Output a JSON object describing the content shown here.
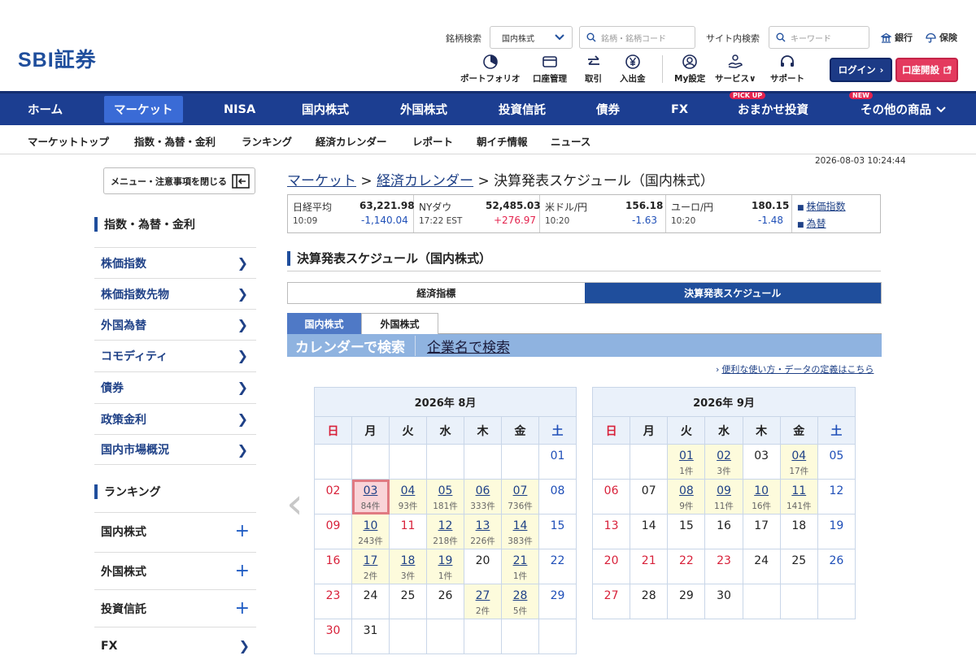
{
  "header": {
    "logo": "SBI証券",
    "stock_search_label": "銘柄検索",
    "stock_search_select": "国内株式",
    "stock_search_placeholder": "銘柄・銘柄コード",
    "site_search_label": "サイト内検索",
    "site_search_placeholder": "キーワード",
    "bank_link": "銀行",
    "insurance_link": "保険",
    "icons": [
      {
        "label": "ポートフォリオ",
        "icon": "portfolio-icon"
      },
      {
        "label": "口座管理",
        "icon": "card-icon"
      },
      {
        "label": "取引",
        "icon": "trade-arrows-icon"
      },
      {
        "label": "入出金",
        "icon": "yen-coin-icon"
      },
      {
        "label": "My設定",
        "icon": "user-icon"
      },
      {
        "label": "サービス",
        "icon": "service-icon"
      },
      {
        "label": "サポート",
        "icon": "headset-icon"
      }
    ],
    "login_label": "ログイン",
    "open_account_label": "口座開設"
  },
  "main_nav": [
    {
      "label": "ホーム"
    },
    {
      "label": "マーケット"
    },
    {
      "label": "NISA"
    },
    {
      "label": "国内株式"
    },
    {
      "label": "外国株式"
    },
    {
      "label": "投資信託"
    },
    {
      "label": "債券"
    },
    {
      "label": "FX"
    },
    {
      "label": "おまかせ投資",
      "badge": "PICK UP"
    },
    {
      "label": "その他の商品",
      "badge": "NEW"
    }
  ],
  "sub_nav": [
    "マーケットトップ",
    "指数・為替・金利",
    "ランキング",
    "経済カレンダー",
    "レポート",
    "朝イチ情報",
    "ニュース"
  ],
  "timestamp": "2026-08-03 10:24:44",
  "sidebar": {
    "close_label": "メニュー・注意事項を閉じる",
    "section1_title": "指数・為替・金利",
    "section1_items": [
      "株価指数",
      "株価指数先物",
      "外国為替",
      "コモディティ",
      "債券",
      "政策金利",
      "国内市場概況"
    ],
    "section2_title": "ランキング",
    "section2_items": [
      "国内株式",
      "外国株式",
      "投資信託",
      "FX"
    ]
  },
  "breadcrumb": {
    "market": "マーケット",
    "calendar": "経済カレンダー",
    "current": "決算発表スケジュール（国内株式）",
    "sep": ">"
  },
  "ticker": [
    {
      "name": "日経平均",
      "value": "63,221.98",
      "time": "10:09",
      "change": "-1,140.04"
    },
    {
      "name": "NYダウ",
      "value": "52,485.03",
      "time": "17:22 EST",
      "change": "+276.97"
    },
    {
      "name": "米ドル/円",
      "value": "156.18",
      "time": "10:20",
      "change": "-1.63"
    },
    {
      "name": "ユーロ/円",
      "value": "180.15",
      "time": "10:20",
      "change": "-1.48"
    }
  ],
  "ticker_links": [
    "株価指数",
    "為替"
  ],
  "page_title": "決算発表スケジュール（国内株式）",
  "tabs": [
    "経済指標",
    "決算発表スケジュール"
  ],
  "sub_tabs": [
    "国内株式",
    "外国株式"
  ],
  "search_modes": [
    "カレンダーで検索",
    "企業名で検索"
  ],
  "help_link": "便利な使い方・データの定義はこちら",
  "weekdays": [
    "日",
    "月",
    "火",
    "水",
    "木",
    "金",
    "土"
  ],
  "calendars": [
    {
      "title": "2026年 8月",
      "weeks": [
        [
          null,
          null,
          null,
          null,
          null,
          null,
          {
            "d": "01"
          }
        ],
        [
          {
            "d": "02"
          },
          {
            "d": "03",
            "c": "84件",
            "today": true
          },
          {
            "d": "04",
            "c": "93件"
          },
          {
            "d": "05",
            "c": "181件"
          },
          {
            "d": "06",
            "c": "333件"
          },
          {
            "d": "07",
            "c": "736件"
          },
          {
            "d": "08"
          }
        ],
        [
          {
            "d": "09"
          },
          {
            "d": "10",
            "c": "243件"
          },
          {
            "d": "11",
            "hol": true
          },
          {
            "d": "12",
            "c": "218件"
          },
          {
            "d": "13",
            "c": "226件"
          },
          {
            "d": "14",
            "c": "383件"
          },
          {
            "d": "15"
          }
        ],
        [
          {
            "d": "16"
          },
          {
            "d": "17",
            "c": "2件"
          },
          {
            "d": "18",
            "c": "3件"
          },
          {
            "d": "19",
            "c": "1件"
          },
          {
            "d": "20"
          },
          {
            "d": "21",
            "c": "1件"
          },
          {
            "d": "22"
          }
        ],
        [
          {
            "d": "23"
          },
          {
            "d": "24"
          },
          {
            "d": "25"
          },
          {
            "d": "26"
          },
          {
            "d": "27",
            "c": "2件"
          },
          {
            "d": "28",
            "c": "5件"
          },
          {
            "d": "29"
          }
        ],
        [
          {
            "d": "30"
          },
          {
            "d": "31"
          },
          null,
          null,
          null,
          null,
          null
        ]
      ]
    },
    {
      "title": "2026年 9月",
      "weeks": [
        [
          null,
          null,
          {
            "d": "01",
            "c": "1件"
          },
          {
            "d": "02",
            "c": "3件"
          },
          {
            "d": "03"
          },
          {
            "d": "04",
            "c": "17件"
          },
          {
            "d": "05"
          }
        ],
        [
          {
            "d": "06"
          },
          {
            "d": "07"
          },
          {
            "d": "08",
            "c": "9件"
          },
          {
            "d": "09",
            "c": "11件"
          },
          {
            "d": "10",
            "c": "16件"
          },
          {
            "d": "11",
            "c": "141件"
          },
          {
            "d": "12"
          }
        ],
        [
          {
            "d": "13"
          },
          {
            "d": "14"
          },
          {
            "d": "15"
          },
          {
            "d": "16"
          },
          {
            "d": "17"
          },
          {
            "d": "18"
          },
          {
            "d": "19"
          }
        ],
        [
          {
            "d": "20"
          },
          {
            "d": "21",
            "hol": true
          },
          {
            "d": "22",
            "hol": true
          },
          {
            "d": "23",
            "hol": true
          },
          {
            "d": "24"
          },
          {
            "d": "25"
          },
          {
            "d": "26"
          }
        ],
        [
          {
            "d": "27"
          },
          {
            "d": "28"
          },
          {
            "d": "29"
          },
          {
            "d": "30"
          },
          null,
          null,
          null
        ]
      ]
    }
  ],
  "colors": {
    "brand": "#1c3e91",
    "accent": "#3a6bd6",
    "login": "#1c3a86",
    "open": "#e43a5e",
    "event_bg": "#fdfbdc",
    "holiday": "#d8213a"
  }
}
